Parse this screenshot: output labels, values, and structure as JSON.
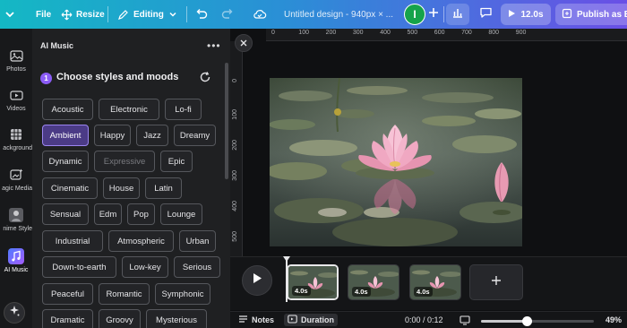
{
  "colors": {
    "brand_gradient_start": "#14b8c4",
    "brand_gradient_end": "#6a4fe6",
    "accent_purple": "#8b5cf6",
    "avatar_green": "#16a34a"
  },
  "topbar": {
    "file_label": "File",
    "resize_label": "Resize",
    "editing_label": "Editing",
    "doc_title": "Untitled design - 940px × ...",
    "avatar_initial": "I",
    "timer_label": "12.0s",
    "publish_label": "Publish as Bra"
  },
  "rail": {
    "items": [
      {
        "label": "Photos",
        "icon": "photo-icon"
      },
      {
        "label": "Videos",
        "icon": "video-icon"
      },
      {
        "label": "ackground",
        "icon": "background-icon"
      },
      {
        "label": "agic Media",
        "icon": "magic-media-icon"
      },
      {
        "label": "nime Style",
        "icon": "anime-style-icon"
      },
      {
        "label": "AI Music",
        "icon": "ai-music-icon"
      }
    ]
  },
  "panel": {
    "title": "AI Music",
    "step_number": "1",
    "step_title": "Choose styles and moods",
    "chips": [
      [
        "Acoustic",
        "Electronic",
        "Lo-fi"
      ],
      [
        "Ambient",
        "Happy",
        "Jazz",
        "Dreamy"
      ],
      [
        "Dynamic",
        "Expressive",
        "Epic"
      ],
      [
        "Cinematic",
        "House",
        "Latin"
      ],
      [
        "Sensual",
        "Edm",
        "Pop",
        "Lounge"
      ],
      [
        "Industrial",
        "Atmospheric",
        "Urban"
      ],
      [
        "Down-to-earth",
        "Low-key",
        "Serious"
      ],
      [
        "Peaceful",
        "Romantic",
        "Symphonic"
      ],
      [
        "Dramatic",
        "Groovy",
        "Mysterious"
      ]
    ],
    "selected_chip": "Ambient",
    "disabled_chip": "Expressive"
  },
  "ruler": {
    "h_ticks": [
      "0",
      "100",
      "200",
      "300",
      "400",
      "500",
      "600",
      "700",
      "800",
      "900"
    ],
    "v_ticks": [
      "0",
      "100",
      "200",
      "300",
      "400",
      "500",
      "600"
    ]
  },
  "timeline": {
    "clips": [
      {
        "label": "4.0s",
        "active": true
      },
      {
        "label": "4.0s",
        "active": false
      },
      {
        "label": "4.0s",
        "active": false
      }
    ]
  },
  "footer": {
    "notes_label": "Notes",
    "duration_label": "Duration",
    "time_readout": "0:00 / 0:12",
    "zoom_percent": 49
  }
}
